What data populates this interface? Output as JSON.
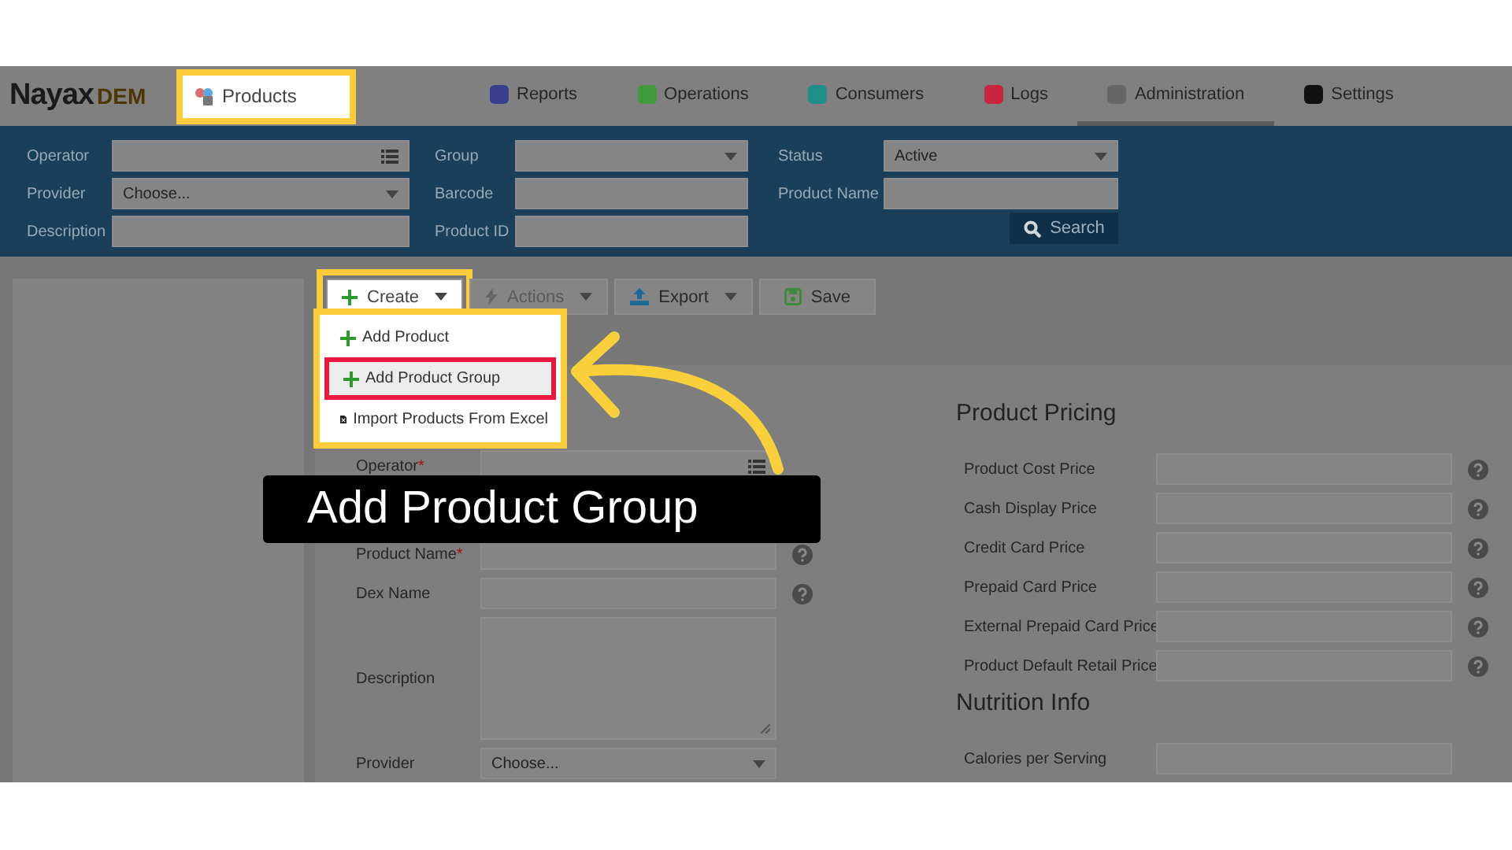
{
  "logo": {
    "name": "Nayax",
    "suffix": "DEM"
  },
  "page_tab": {
    "label": "Products",
    "highlighted": true
  },
  "nav": [
    {
      "label": "Reports",
      "selected": false,
      "color": "#3a3d8f"
    },
    {
      "label": "Operations",
      "selected": false,
      "color": "#3f9a3f"
    },
    {
      "label": "Consumers",
      "selected": false,
      "color": "#1f8f86"
    },
    {
      "label": "Logs",
      "selected": false,
      "color": "#c8233f"
    },
    {
      "label": "Administration",
      "selected": true,
      "color": "#666666"
    },
    {
      "label": "Settings",
      "selected": false,
      "color": "#111111"
    }
  ],
  "filters": [
    {
      "label": "Operator",
      "kind": "list"
    },
    {
      "label": "Group",
      "kind": "select"
    },
    {
      "label": "Status",
      "kind": "select",
      "value": "Active"
    },
    {
      "label": "Provider",
      "kind": "select",
      "value": "Choose..."
    },
    {
      "label": "Barcode",
      "kind": "text"
    },
    {
      "label": "Product Name",
      "kind": "text"
    },
    {
      "label": "Description",
      "kind": "text"
    },
    {
      "label": "Product ID",
      "kind": "text"
    }
  ],
  "search_button": {
    "label": "Search"
  },
  "toolbar": [
    {
      "label": "Create",
      "kind": "create",
      "dropdown": true,
      "disabled": false,
      "highlighted": true
    },
    {
      "label": "Actions",
      "kind": "actions",
      "dropdown": true,
      "disabled": true,
      "highlighted": false
    },
    {
      "label": "Export",
      "kind": "export",
      "dropdown": true,
      "disabled": false,
      "highlighted": false
    },
    {
      "label": "Save",
      "kind": "save",
      "dropdown": false,
      "disabled": false,
      "highlighted": false
    }
  ],
  "create_menu": [
    {
      "label": "Add Product",
      "kind": "add",
      "highlighted": false
    },
    {
      "label": "Add Product Group",
      "kind": "add",
      "highlighted": true
    },
    {
      "label": "Import Products From Excel",
      "kind": "import",
      "highlighted": false
    }
  ],
  "product_form": [
    {
      "label": "Operator",
      "mark": "*",
      "kind": "list",
      "help": false
    },
    {
      "label": "Product Name",
      "mark": "*",
      "kind": "text",
      "help": true
    },
    {
      "label": "Dex Name",
      "kind": "text",
      "help": true
    },
    {
      "label": "Description",
      "kind": "textarea",
      "help": false
    },
    {
      "label": "Provider",
      "kind": "select",
      "value": "Choose...",
      "help": false
    }
  ],
  "pricing": {
    "title": "Product Pricing",
    "rows": [
      {
        "label": "Product Cost Price",
        "help": true
      },
      {
        "label": "Cash Display Price",
        "help": true
      },
      {
        "label": "Credit Card Price",
        "help": true
      },
      {
        "label": "Prepaid Card Price",
        "help": true
      },
      {
        "label": "External Prepaid Card Price",
        "help": true
      },
      {
        "label": "Product Default Retail Price",
        "help": true
      }
    ]
  },
  "nutrition": {
    "title": "Nutrition Info",
    "rows": [
      {
        "label": "Calories per Serving",
        "help": false
      }
    ]
  },
  "callout": {
    "text": "Add Product Group"
  }
}
